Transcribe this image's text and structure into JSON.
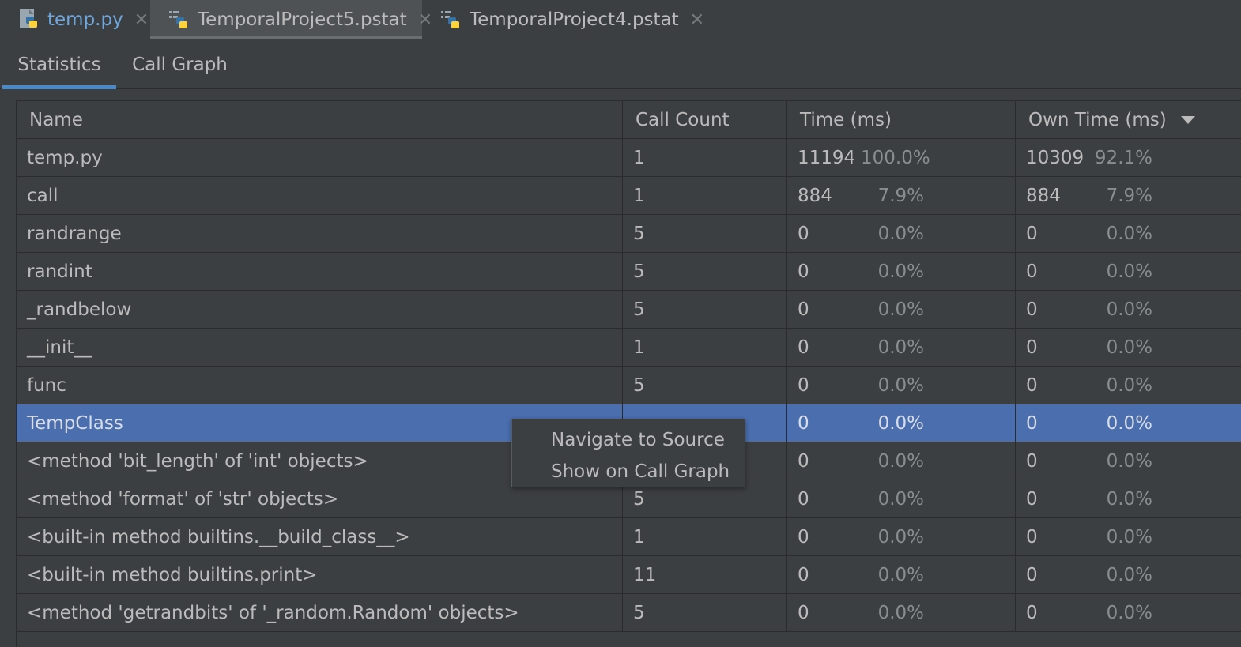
{
  "editor_tabs": [
    {
      "label": "temp.py",
      "icon": "python-file-icon",
      "active": false
    },
    {
      "label": "TemporalProject5.pstat",
      "icon": "profiler-stats-icon",
      "active": true
    },
    {
      "label": "TemporalProject4.pstat",
      "icon": "profiler-stats-icon",
      "active": false
    }
  ],
  "close_glyph": "✕",
  "tool_tabs": [
    {
      "label": "Statistics",
      "active": true
    },
    {
      "label": "Call Graph",
      "active": false
    }
  ],
  "table": {
    "columns": [
      "Name",
      "Call Count",
      "Time (ms)",
      "Own Time (ms)"
    ],
    "sort_column": "Own Time (ms)",
    "sort_direction": "descending",
    "rows": [
      {
        "name": "temp.py",
        "count": "1",
        "time": "11194",
        "time_pct": "100.0%",
        "own": "10309",
        "own_pct": "92.1%"
      },
      {
        "name": "call",
        "count": "1",
        "time": "884",
        "time_pct": "7.9%",
        "own": "884",
        "own_pct": "7.9%"
      },
      {
        "name": "randrange",
        "count": "5",
        "time": "0",
        "time_pct": "0.0%",
        "own": "0",
        "own_pct": "0.0%"
      },
      {
        "name": "randint",
        "count": "5",
        "time": "0",
        "time_pct": "0.0%",
        "own": "0",
        "own_pct": "0.0%"
      },
      {
        "name": "_randbelow",
        "count": "5",
        "time": "0",
        "time_pct": "0.0%",
        "own": "0",
        "own_pct": "0.0%"
      },
      {
        "name": "__init__",
        "count": "1",
        "time": "0",
        "time_pct": "0.0%",
        "own": "0",
        "own_pct": "0.0%"
      },
      {
        "name": "func",
        "count": "5",
        "time": "0",
        "time_pct": "0.0%",
        "own": "0",
        "own_pct": "0.0%"
      },
      {
        "name": "TempClass",
        "count": "",
        "time": "0",
        "time_pct": "0.0%",
        "own": "0",
        "own_pct": "0.0%"
      },
      {
        "name": "<method 'bit_length' of 'int' objects>",
        "count": "",
        "time": "0",
        "time_pct": "0.0%",
        "own": "0",
        "own_pct": "0.0%"
      },
      {
        "name": "<method 'format' of 'str' objects>",
        "count": "5",
        "time": "0",
        "time_pct": "0.0%",
        "own": "0",
        "own_pct": "0.0%"
      },
      {
        "name": "<built-in method builtins.__build_class__>",
        "count": "1",
        "time": "0",
        "time_pct": "0.0%",
        "own": "0",
        "own_pct": "0.0%"
      },
      {
        "name": "<built-in method builtins.print>",
        "count": "11",
        "time": "0",
        "time_pct": "0.0%",
        "own": "0",
        "own_pct": "0.0%"
      },
      {
        "name": "<method 'getrandbits' of '_random.Random' objects>",
        "count": "5",
        "time": "0",
        "time_pct": "0.0%",
        "own": "0",
        "own_pct": "0.0%"
      }
    ],
    "selected_row": "TempClass"
  },
  "context_menu": {
    "items": [
      "Navigate to Source",
      "Show on Call Graph"
    ]
  },
  "colors": {
    "background": "#3c3f41",
    "selection": "#4b6eaf",
    "active_tab_underline": "#4a88c7",
    "python_tab_text": "#6fa6dc",
    "python_blue": "#3572a5",
    "python_yellow": "#ffd43b"
  }
}
